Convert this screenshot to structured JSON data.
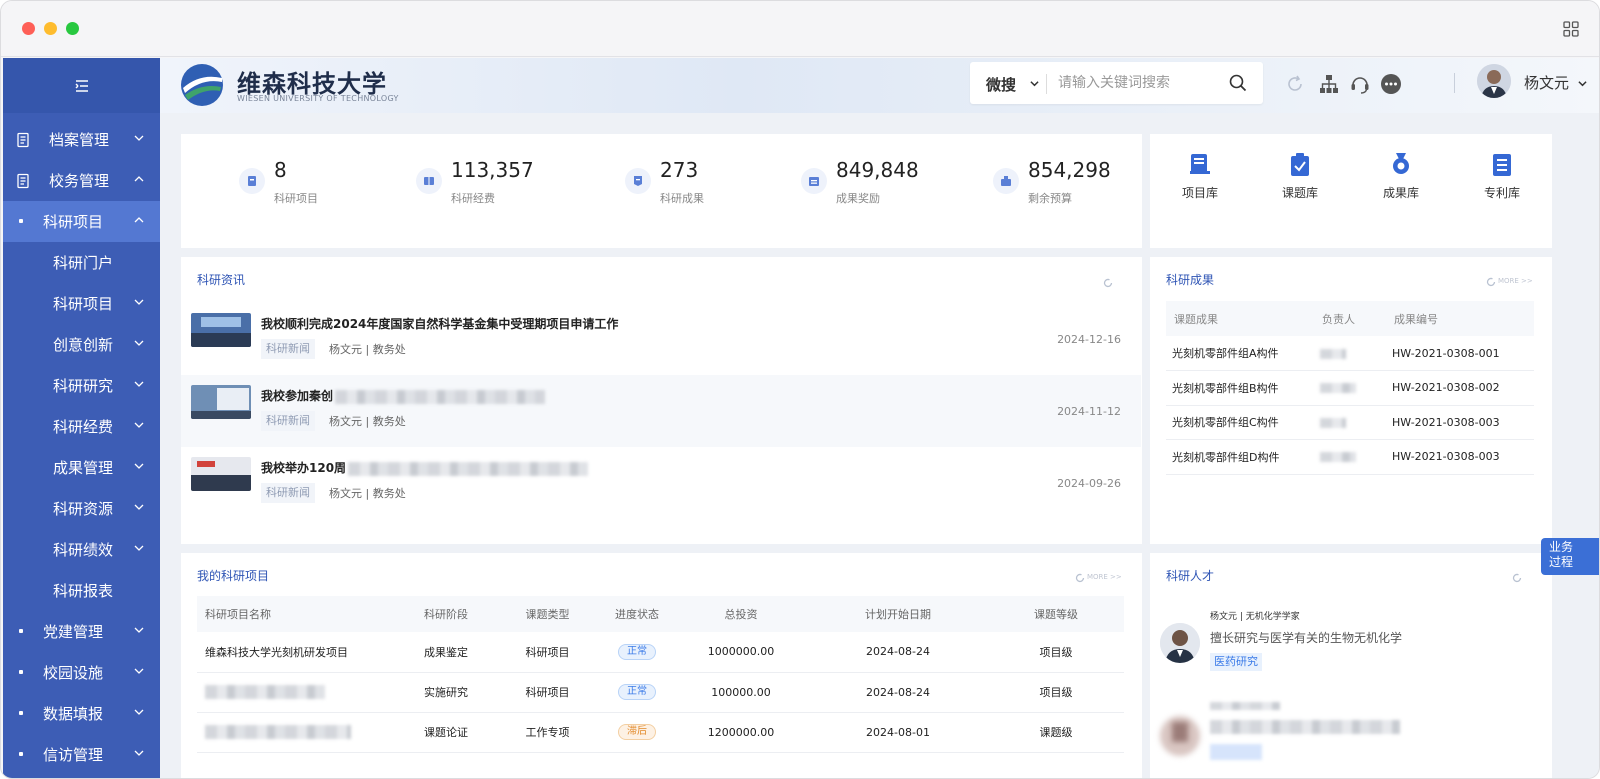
{
  "window": {
    "traffic_colors": [
      "#fe5f57",
      "#febc2e",
      "#28c840"
    ]
  },
  "sidebar": {
    "items": [
      {
        "label": "档案管理",
        "kind": "group",
        "chevron": "down"
      },
      {
        "label": "校务管理",
        "kind": "group",
        "chevron": "up"
      },
      {
        "label": "科研项目",
        "kind": "sub-active",
        "chevron": "up"
      },
      {
        "label": "科研门户",
        "kind": "leaf",
        "chevron": ""
      },
      {
        "label": "科研项目",
        "kind": "leaf",
        "chevron": "down"
      },
      {
        "label": "创意创新",
        "kind": "leaf",
        "chevron": "down"
      },
      {
        "label": "科研研究",
        "kind": "leaf",
        "chevron": "down"
      },
      {
        "label": "科研经费",
        "kind": "leaf",
        "chevron": "down"
      },
      {
        "label": "成果管理",
        "kind": "leaf",
        "chevron": "down"
      },
      {
        "label": "科研资源",
        "kind": "leaf",
        "chevron": "down"
      },
      {
        "label": "科研绩效",
        "kind": "leaf",
        "chevron": "down"
      },
      {
        "label": "科研报表",
        "kind": "leaf",
        "chevron": ""
      },
      {
        "label": "党建管理",
        "kind": "bullet",
        "chevron": "down"
      },
      {
        "label": "校园设施",
        "kind": "bullet",
        "chevron": "down"
      },
      {
        "label": "数据填报",
        "kind": "bullet",
        "chevron": "down"
      },
      {
        "label": "信访管理",
        "kind": "bullet",
        "chevron": "down"
      }
    ]
  },
  "header": {
    "logo_cn": "维森科技大学",
    "logo_en": "WIESEN UNIVERSITY OF TECHNOLOGY",
    "search_type": "微搜",
    "search_placeholder": "请输入关键词搜索",
    "user_name": "杨文元",
    "icons": [
      "refresh-icon",
      "org-chart-icon",
      "customer-service-icon",
      "more-icon"
    ]
  },
  "stats": [
    {
      "value": "8",
      "label": "科研项目",
      "icon": "project-icon"
    },
    {
      "value": "113,357",
      "label": "科研经费",
      "icon": "funding-icon"
    },
    {
      "value": "273",
      "label": "科研成果",
      "icon": "achievement-icon"
    },
    {
      "value": "849,848",
      "label": "成果奖励",
      "icon": "reward-icon"
    },
    {
      "value": "854,298",
      "label": "剩余预算",
      "icon": "budget-icon"
    }
  ],
  "libraries": [
    {
      "label": "项目库",
      "icon": "project-library-icon"
    },
    {
      "label": "课题库",
      "icon": "topic-library-icon"
    },
    {
      "label": "成果库",
      "icon": "achievement-library-icon"
    },
    {
      "label": "专利库",
      "icon": "patent-library-icon"
    }
  ],
  "news": {
    "title": "科研资讯",
    "items": [
      {
        "title": "我校顺利完成2024年度国家自然科学基金集中受理期项目申请工作",
        "tag": "科研新闻",
        "meta": "杨文元 | 教务处",
        "date": "2024-12-16"
      },
      {
        "title": "我校参加秦创",
        "tag": "科研新闻",
        "meta": "杨文元 | 教务处",
        "date": "2024-11-12"
      },
      {
        "title": "我校举办120周",
        "tag": "科研新闻",
        "meta": "杨文元 | 教务处",
        "date": "2024-09-26"
      }
    ]
  },
  "results": {
    "title": "科研成果",
    "more": "MORE >>",
    "columns": [
      "课题成果",
      "负责人",
      "成果编号"
    ],
    "rows": [
      {
        "name": "光刻机零部件组A构件",
        "code": "HW-2021-0308-001"
      },
      {
        "name": "光刻机零部件组B构件",
        "code": "HW-2021-0308-002"
      },
      {
        "name": "光刻机零部件组C构件",
        "code": "HW-2021-0308-003"
      },
      {
        "name": "光刻机零部件组D构件",
        "code": "HW-2021-0308-003"
      }
    ]
  },
  "projects": {
    "title": "我的科研项目",
    "more": "MORE >>",
    "columns": [
      "科研项目名称",
      "科研阶段",
      "课题类型",
      "进度状态",
      "总投资",
      "计划开始日期",
      "课题等级"
    ],
    "rows": [
      {
        "name": "维森科技大学光刻机研发项目",
        "stage": "成果鉴定",
        "type": "科研项目",
        "status": "正常",
        "status_kind": "ok",
        "invest": "1000000.00",
        "date": "2024-08-24",
        "level": "项目级"
      },
      {
        "name": "",
        "stage": "实施研究",
        "type": "科研项目",
        "status": "正常",
        "status_kind": "ok",
        "invest": "100000.00",
        "date": "2024-08-24",
        "level": "项目级"
      },
      {
        "name": "",
        "stage": "课题论证",
        "type": "工作专项",
        "status": "滞后",
        "status_kind": "late",
        "invest": "1200000.00",
        "date": "2024-08-01",
        "level": "课题级"
      }
    ]
  },
  "talent": {
    "title": "科研人才",
    "items": [
      {
        "name": "杨文元 | 无机化学学家",
        "desc": "擅长研究与医学有关的生物无机化学",
        "tag": "医药研究"
      }
    ]
  },
  "float_tab": {
    "line1": "业务",
    "line2": "过程"
  }
}
